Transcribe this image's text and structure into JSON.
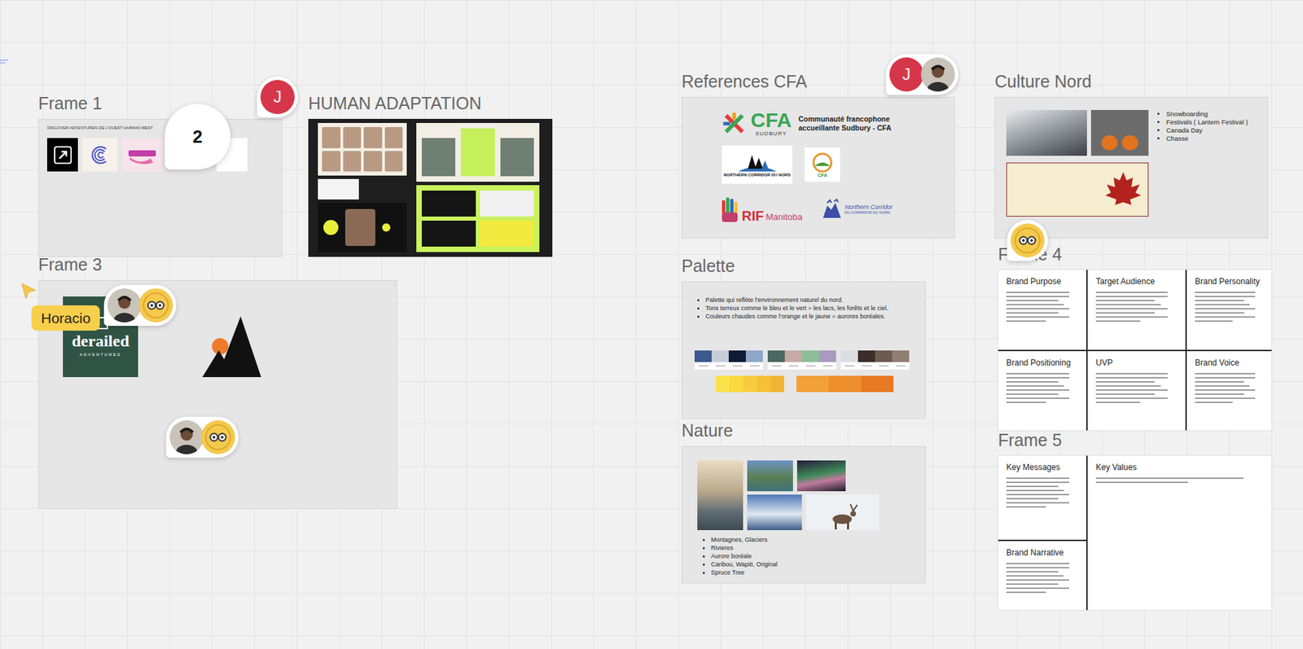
{
  "frame1": {
    "title": "Frame 1",
    "caption": "DISCOVER ADVENTURES DE L'OUEST HUMAIN WEST"
  },
  "moodboard": {
    "title": "HUMAN ADAPTATION"
  },
  "frame3": {
    "title": "Frame 3",
    "logo": {
      "name": "derailed",
      "tagline": "ADVENTURES"
    }
  },
  "references": {
    "title": "References CFA",
    "cfa": {
      "mark": "CFA",
      "city": "SUDBURY",
      "name": "Communauté francophone accueillante Sudbury - CFA"
    },
    "corridor": {
      "line1": "NORTHERN CORRIDOR DU NORD"
    },
    "badge": "CFA",
    "rif": {
      "mark": "RIF",
      "region": "Manitoba"
    },
    "corridor2": {
      "line1": "Northern Corridor",
      "line2": "DU CORRIDOR DU NORD"
    }
  },
  "culture": {
    "title": "Culture Nord",
    "bullets": [
      "Snowboarding",
      "Festivals ( Lantern Festival )",
      "Canada Day",
      "Chasse"
    ]
  },
  "palette": {
    "title": "Palette",
    "bullets": [
      "Palette qui reflète l'environnement naturel du nord.",
      "Tons terreux comme le bleu et le vert = les lacs, les forêts et le ciel.",
      "Couleurs chaudes comme l'orange et le jaune = aurores boréales."
    ],
    "groups": [
      {
        "swatches": [
          {
            "color": "#3c5a8d"
          },
          {
            "color": "#c8ccd6"
          },
          {
            "color": "#0f1b34"
          },
          {
            "color": "#8ea7cb"
          }
        ]
      },
      {
        "swatches": [
          {
            "color": "#4b6862"
          },
          {
            "color": "#c6aaa5"
          },
          {
            "color": "#8dbf98"
          },
          {
            "color": "#a79abf"
          }
        ]
      },
      {
        "swatches": [
          {
            "color": "#dcdde3"
          },
          {
            "color": "#3c2e2a"
          },
          {
            "color": "#6c5b51"
          },
          {
            "color": "#917e72"
          }
        ]
      }
    ],
    "warm": [
      {
        "shades": [
          {
            "color": "#fbe24a"
          },
          {
            "color": "#f9d840"
          },
          {
            "color": "#f7cc3c"
          },
          {
            "color": "#f4c038"
          },
          {
            "color": "#f2b436"
          }
        ]
      },
      {
        "shades": [
          {
            "color": "#f2a03a"
          },
          {
            "color": "#ee8f2e"
          },
          {
            "color": "#e97a24"
          }
        ]
      }
    ]
  },
  "nature": {
    "title": "Nature",
    "bullets": [
      "Montagnes, Glaciers",
      "Rivieres",
      "Aurore boréale",
      "Caribou, Wapiti, Original",
      "Spruce Tree"
    ]
  },
  "frame4": {
    "title": "Frame 4",
    "cells": [
      {
        "label": "Brand Purpose"
      },
      {
        "label": "Target Audience"
      },
      {
        "label": "Brand Personality"
      },
      {
        "label": "Brand Positioning"
      },
      {
        "label": "UVP"
      },
      {
        "label": "Brand Voice"
      }
    ]
  },
  "frame5": {
    "title": "Frame 5",
    "cells": [
      {
        "label": "Key Messages"
      },
      {
        "label": "Key Values"
      },
      {
        "label": "Brand Narrative"
      }
    ]
  },
  "comment": {
    "count": "2"
  },
  "cursor": {
    "name": "Horacio"
  },
  "presence": [
    {
      "members": [
        {
          "kind": "initial",
          "initial": "J"
        }
      ]
    },
    {
      "members": [
        {
          "kind": "initial",
          "initial": "J"
        },
        {
          "kind": "photo"
        }
      ]
    },
    {
      "members": [
        {
          "kind": "photo"
        },
        {
          "kind": "logo"
        }
      ]
    },
    {
      "members": [
        {
          "kind": "photo"
        },
        {
          "kind": "logo"
        }
      ]
    },
    {
      "members": [
        {
          "kind": "logo"
        }
      ]
    }
  ]
}
